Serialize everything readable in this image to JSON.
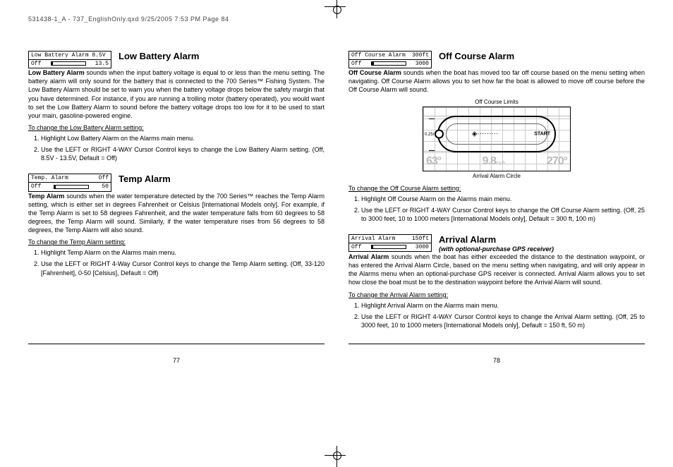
{
  "header_slug": "531438-1_A - 737_EnglishOnly.qxd  9/25/2005  7:53 PM  Page 84",
  "left_page_num": "77",
  "right_page_num": "78",
  "low_battery": {
    "widget_top": "Low Battery Alarm 8.5V",
    "widget_state": "Off",
    "widget_max": "13.5",
    "title": "Low Battery Alarm",
    "body": "Low Battery Alarm sounds when the input battery voltage is equal to or less than the menu setting. The battery alarm will only sound for the battery that is connected to the 700 Series™ Fishing System. The Low Battery Alarm should be set to warn you when the battery voltage drops below the safety margin that you have determined. For instance, if you are running a trolling motor (battery operated), you would want to set the Low Battery Alarm to sound before the battery voltage drops too low for it to be used to start your main, gasoline-powered engine.",
    "instr_title": "To change the Low Battery Alarm setting:",
    "step1": "Highlight Low Battery Alarm on the Alarms main menu.",
    "step2": "Use the LEFT or RIGHT 4-WAY Cursor Control keys to change the Low Battery Alarm setting. (Off, 8.5V - 13.5V,  Default = Off)"
  },
  "temp": {
    "widget_top": "Temp. Alarm",
    "widget_top_right": "Off",
    "widget_state": "Off",
    "widget_max": "50",
    "title": "Temp Alarm",
    "body": "Temp Alarm sounds when the water temperature detected by the 700 Series™ reaches the Temp Alarm setting, which is either set in degrees Fahrenheit or Celsius [International Models only]. For example, if the Temp Alarm is set to 58 degrees Fahrenheit, and the water temperature falls from 60 degrees to 58 degrees, the Temp Alarm will sound. Similarly, if the water temperature rises from 56 degrees to 58 degrees, the Temp Alarm will also sound.",
    "instr_title": "To change the Temp Alarm setting:",
    "step1": "Highlight Temp Alarm on the Alarms main menu.",
    "step2": "Use the LEFT or RIGHT 4-Way Cursor Control keys to change the Temp Alarm setting. (Off, 33-120 [Fahrenheit], 0-50 [Celsius], Default = Off)"
  },
  "offcourse": {
    "widget_top": "Off Course Alarm",
    "widget_top_right": "300ft",
    "widget_state": "Off",
    "widget_max": "3000",
    "title": "Off Course Alarm",
    "body": "Off Course Alarm sounds when the boat has moved too far off course based on the menu setting when navigating. Off Course Alarm allows you to set how far the boat is allowed to move off course before the Off Course Alarm will sound.",
    "fig_top": "Off Course Limits",
    "fig_limit": "0.25nm",
    "fig_start": "START",
    "fig_v1": "63°",
    "fig_v2": "9.8",
    "fig_v2u": "mph",
    "fig_v3": "270°",
    "fig_bot": "Arrival Alarm Circle",
    "instr_title": "To change the Off Course Alarm setting:",
    "step1": "Highlight Off Course Alarm on the Alarms main  menu.",
    "step2": "Use the LEFT or RIGHT 4-WAY Cursor Control keys to change the Off Course Alarm setting. (Off, 25 to 3000 feet, 10 to 1000 meters [International Models only], Default = 300 ft, 100 m)"
  },
  "arrival": {
    "widget_top": "Arrival Alarm",
    "widget_top_right": "150ft",
    "widget_state": "Off",
    "widget_max": "3000",
    "title": "Arrival Alarm",
    "subtitle": "(with optional-purchase GPS receiver)",
    "body": "Arrival Alarm sounds when the boat has either exceeded the distance to the destination waypoint, or has entered the Arrival Alarm Circle, based on the menu setting when navigating, and will only appear in the Alarms menu when an optional-purchase GPS receiver is connected. Arrival Alarm allows you to set how close the boat must be to the destination waypoint before the Arrival Alarm will sound.",
    "instr_title": "To change the Arrival Alarm setting:",
    "step1": "Highlight Arrival Alarm on the Alarms main menu.",
    "step2": "Use the LEFT or RIGHT 4-WAY Cursor Control keys to change the Arrival Alarm setting. (Off, 25 to 3000 feet, 10 to 1000 meters [International Models only], Default = 150 ft, 50 m)"
  }
}
